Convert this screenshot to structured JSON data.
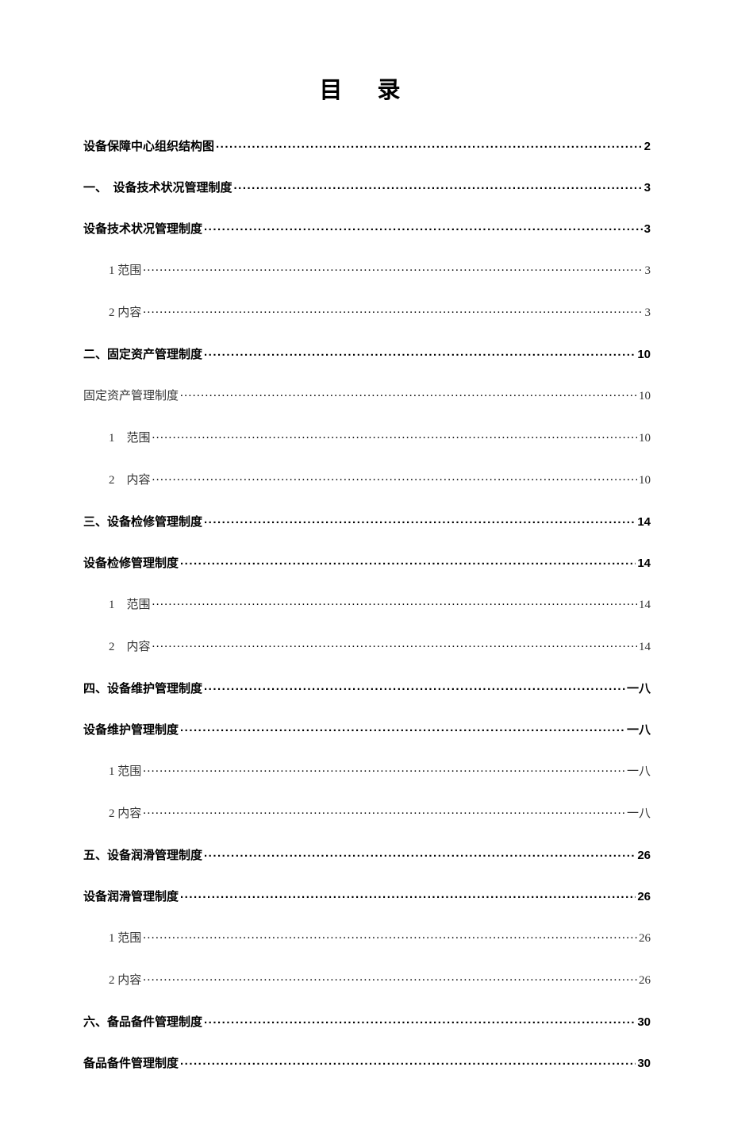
{
  "title": "目 录",
  "toc": [
    {
      "label": "设备保障中心组织结构图",
      "page": "2",
      "bold": true,
      "indent": 0
    },
    {
      "label": "一、　设备技术状况管理制度",
      "page": "3",
      "bold": true,
      "indent": 0
    },
    {
      "label": "设备技术状况管理制度",
      "page": "3",
      "bold": true,
      "indent": 0
    },
    {
      "label": "1 范围",
      "page": "3",
      "bold": false,
      "indent": 2
    },
    {
      "label": "2 内容",
      "page": "3",
      "bold": false,
      "indent": 2
    },
    {
      "label": "二、固定资产管理制度",
      "page": "10",
      "bold": true,
      "indent": 0
    },
    {
      "label": "固定资产管理制度",
      "page": "10",
      "bold": false,
      "indent": 0
    },
    {
      "label": "1　范围",
      "page": "10",
      "bold": false,
      "indent": 2
    },
    {
      "label": "2　内容",
      "page": "10",
      "bold": false,
      "indent": 2
    },
    {
      "label": "三、设备检修管理制度",
      "page": "14",
      "bold": true,
      "indent": 0
    },
    {
      "label": "设备检修管理制度",
      "page": "14",
      "bold": true,
      "indent": 0
    },
    {
      "label": "1　范围",
      "page": "14",
      "bold": false,
      "indent": 2
    },
    {
      "label": "2　内容",
      "page": "14",
      "bold": false,
      "indent": 2
    },
    {
      "label": "四、设备维护管理制度",
      "page": "一八",
      "bold": true,
      "indent": 0
    },
    {
      "label": "设备维护管理制度",
      "page": "一八",
      "bold": true,
      "indent": 0
    },
    {
      "label": "1 范围",
      "page": "一八",
      "bold": false,
      "indent": 2
    },
    {
      "label": "2 内容",
      "page": "一八",
      "bold": false,
      "indent": 2
    },
    {
      "label": "五、设备润滑管理制度",
      "page": "26",
      "bold": true,
      "indent": 0
    },
    {
      "label": "设备润滑管理制度",
      "page": "26",
      "bold": true,
      "indent": 0
    },
    {
      "label": "1 范围",
      "page": "26",
      "bold": false,
      "indent": 2
    },
    {
      "label": "2 内容",
      "page": "26",
      "bold": false,
      "indent": 2
    },
    {
      "label": "六、备品备件管理制度",
      "page": "30",
      "bold": true,
      "indent": 0
    },
    {
      "label": "备品备件管理制度",
      "page": "30",
      "bold": true,
      "indent": 0
    }
  ]
}
